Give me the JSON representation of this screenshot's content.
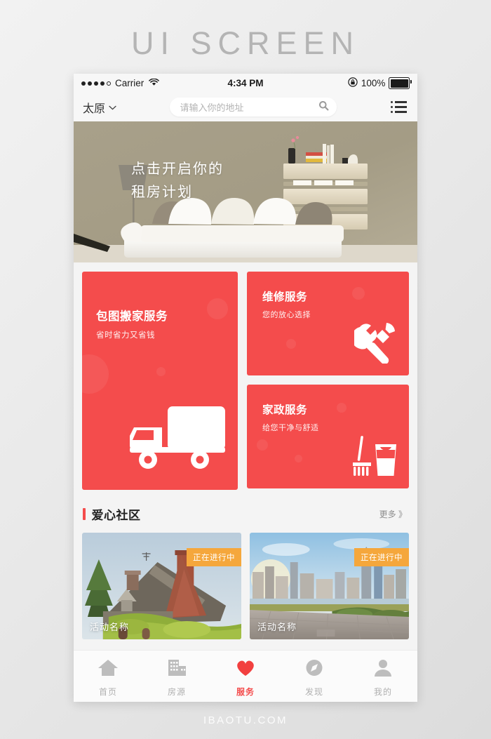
{
  "page": {
    "title": "UI SCREEN",
    "footer": "IBAOTU.COM"
  },
  "colors": {
    "accent_red": "#F44C4C",
    "badge_orange": "#F5A73C",
    "tab_inactive": "#B0B0B0",
    "page_bg": "#EDEDED"
  },
  "statusbar": {
    "carrier": "Carrier",
    "time": "4:34 PM",
    "battery_percent": "100%"
  },
  "topbar": {
    "city": "太原",
    "search_placeholder": "请输入你的地址"
  },
  "hero": {
    "line1": "点击开启你的",
    "line2": "租房计划"
  },
  "services": [
    {
      "title": "包图搬家服务",
      "subtitle": "省时省力又省钱",
      "icon": "moving-truck-icon"
    },
    {
      "title": "维修服务",
      "subtitle": "您的放心选择",
      "icon": "wrench-hammer-icon"
    },
    {
      "title": "家政服务",
      "subtitle": "给您干净与舒适",
      "icon": "broom-bucket-icon"
    }
  ],
  "community": {
    "section_title": "爱心社区",
    "more_label": "更多 》",
    "activities": [
      {
        "badge": "正在进行中",
        "name": "活动名称",
        "scene": "countryside-cottage"
      },
      {
        "badge": "正在进行中",
        "name": "活动名称",
        "scene": "city-skyline"
      }
    ]
  },
  "tabbar": [
    {
      "label": "首页",
      "icon": "home-icon",
      "active": false
    },
    {
      "label": "房源",
      "icon": "building-icon",
      "active": false
    },
    {
      "label": "服务",
      "icon": "heart-icon",
      "active": true
    },
    {
      "label": "发现",
      "icon": "compass-icon",
      "active": false
    },
    {
      "label": "我的",
      "icon": "person-icon",
      "active": false
    }
  ]
}
